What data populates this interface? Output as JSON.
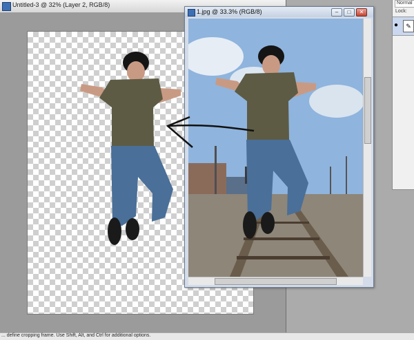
{
  "window_untitled": {
    "title": "Untitled-3 @ 32% (Layer 2, RGB/8)"
  },
  "window_photo": {
    "title": "1.jpg @ 33.3% (RGB/8)",
    "minimize_label": "–",
    "maximize_label": "□",
    "close_label": "✕"
  },
  "layers_panel": {
    "blend_mode": "Normal",
    "lock_label": "Lock:",
    "eye_glyph": "●",
    "brush_glyph": "✎"
  },
  "status_bar": {
    "text": "... define cropping frame. Use Shift, Alt, and Ctrl for additional options."
  },
  "icons": {
    "app_icon": "photoshop-document-icon",
    "visibility": "eye-icon",
    "brush": "brush-icon",
    "arrow": "hand-drawn-arrow"
  },
  "colors": {
    "sky": "#8fb4dd",
    "shirt": "#5d5b44",
    "jeans": "#4a6f98",
    "track": "#5b4a3a"
  }
}
